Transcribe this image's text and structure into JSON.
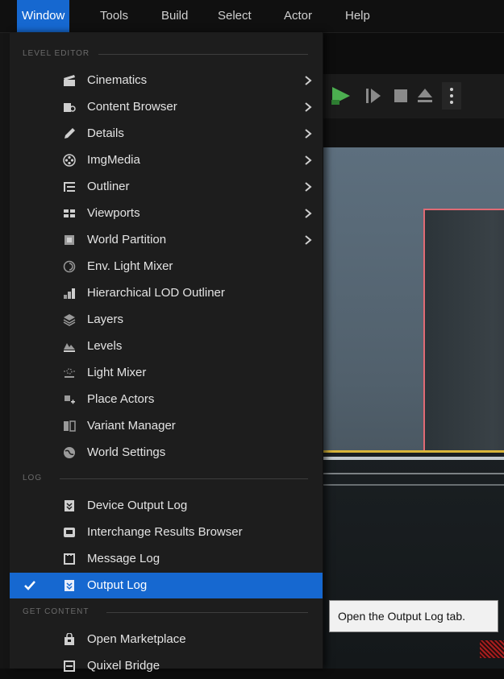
{
  "menubar": {
    "items": [
      {
        "label": "Window",
        "active": true
      },
      {
        "label": "Tools"
      },
      {
        "label": "Build"
      },
      {
        "label": "Select"
      },
      {
        "label": "Actor"
      },
      {
        "label": "Help"
      }
    ]
  },
  "menu": {
    "sections": [
      {
        "title": "LEVEL EDITOR"
      },
      {
        "title": "LOG"
      },
      {
        "title": "GET CONTENT"
      }
    ],
    "level_editor_items": [
      {
        "label": "Cinematics",
        "icon": "cinematics-icon",
        "submenu": true
      },
      {
        "label": "Content Browser",
        "icon": "content-browser-icon",
        "submenu": true
      },
      {
        "label": "Details",
        "icon": "details-icon",
        "submenu": true
      },
      {
        "label": "ImgMedia",
        "icon": "imgmedia-icon",
        "submenu": true
      },
      {
        "label": "Outliner",
        "icon": "outliner-icon",
        "submenu": true
      },
      {
        "label": "Viewports",
        "icon": "viewports-icon",
        "submenu": true
      },
      {
        "label": "World Partition",
        "icon": "world-partition-icon",
        "submenu": true
      },
      {
        "label": "Env. Light Mixer",
        "icon": "env-light-mixer-icon"
      },
      {
        "label": "Hierarchical LOD Outliner",
        "icon": "hlod-outliner-icon"
      },
      {
        "label": "Layers",
        "icon": "layers-icon"
      },
      {
        "label": "Levels",
        "icon": "levels-icon"
      },
      {
        "label": "Light Mixer",
        "icon": "light-mixer-icon"
      },
      {
        "label": "Place Actors",
        "icon": "place-actors-icon"
      },
      {
        "label": "Variant Manager",
        "icon": "variant-manager-icon"
      },
      {
        "label": "World Settings",
        "icon": "world-settings-icon"
      }
    ],
    "log_items": [
      {
        "label": "Device Output Log",
        "icon": "device-output-log-icon"
      },
      {
        "label": "Interchange Results Browser",
        "icon": "interchange-results-icon"
      },
      {
        "label": "Message Log",
        "icon": "message-log-icon"
      },
      {
        "label": "Output Log",
        "icon": "output-log-icon",
        "checked": true,
        "selected": true
      }
    ],
    "get_content_items": [
      {
        "label": "Open Marketplace",
        "icon": "marketplace-icon"
      },
      {
        "label": "Quixel Bridge",
        "icon": "quixel-bridge-icon"
      }
    ]
  },
  "tooltip": {
    "text": "Open the Output Log tab."
  },
  "colors": {
    "accent": "#1668d0",
    "menu_bg": "#1d1d1d",
    "play_green": "#4caf50",
    "selection_outline": "#e06a74",
    "ground_line": "#d8b53a"
  }
}
